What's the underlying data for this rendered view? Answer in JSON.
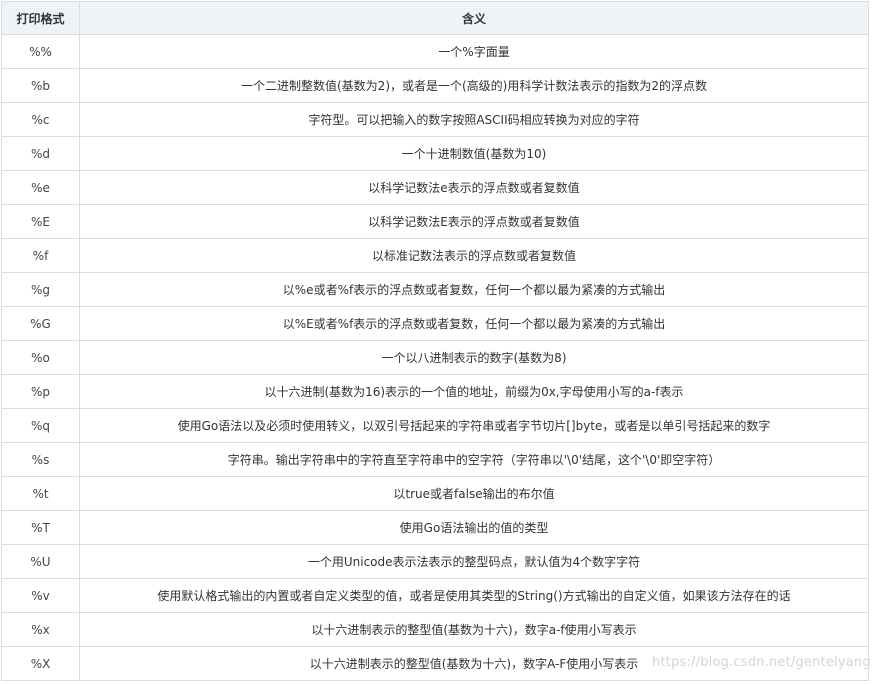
{
  "table": {
    "headers": [
      "打印格式",
      "含义"
    ],
    "rows": [
      {
        "format": "%%",
        "meaning": "一个%字面量"
      },
      {
        "format": "%b",
        "meaning": "一个二进制整数值(基数为2)，或者是一个(高级的)用科学计数法表示的指数为2的浮点数"
      },
      {
        "format": "%c",
        "meaning": "字符型。可以把输入的数字按照ASCII码相应转换为对应的字符"
      },
      {
        "format": "%d",
        "meaning": "一个十进制数值(基数为10)"
      },
      {
        "format": "%e",
        "meaning": "以科学记数法e表示的浮点数或者复数值"
      },
      {
        "format": "%E",
        "meaning": "以科学记数法E表示的浮点数或者复数值"
      },
      {
        "format": "%f",
        "meaning": "以标准记数法表示的浮点数或者复数值"
      },
      {
        "format": "%g",
        "meaning": "以%e或者%f表示的浮点数或者复数，任何一个都以最为紧凑的方式输出"
      },
      {
        "format": "%G",
        "meaning": "以%E或者%f表示的浮点数或者复数，任何一个都以最为紧凑的方式输出"
      },
      {
        "format": "%o",
        "meaning": "一个以八进制表示的数字(基数为8)"
      },
      {
        "format": "%p",
        "meaning": "以十六进制(基数为16)表示的一个值的地址，前缀为0x,字母使用小写的a-f表示"
      },
      {
        "format": "%q",
        "meaning": "使用Go语法以及必须时使用转义，以双引号括起来的字符串或者字节切片[]byte，或者是以单引号括起来的数字"
      },
      {
        "format": "%s",
        "meaning": "字符串。输出字符串中的字符直至字符串中的空字符（字符串以'\\0'结尾，这个'\\0'即空字符）"
      },
      {
        "format": "%t",
        "meaning": "以true或者false输出的布尔值"
      },
      {
        "format": "%T",
        "meaning": "使用Go语法输出的值的类型"
      },
      {
        "format": "%U",
        "meaning": "一个用Unicode表示法表示的整型码点，默认值为4个数字字符"
      },
      {
        "format": "%v",
        "meaning": "使用默认格式输出的内置或者自定义类型的值，或者是使用其类型的String()方式输出的自定义值，如果该方法存在的话"
      },
      {
        "format": "%x",
        "meaning": "以十六进制表示的整型值(基数为十六)，数字a-f使用小写表示"
      },
      {
        "format": "%X",
        "meaning": "以十六进制表示的整型值(基数为十六)，数字A-F使用小写表示"
      }
    ]
  },
  "watermark": "https://blog.csdn.net/gentelyang"
}
